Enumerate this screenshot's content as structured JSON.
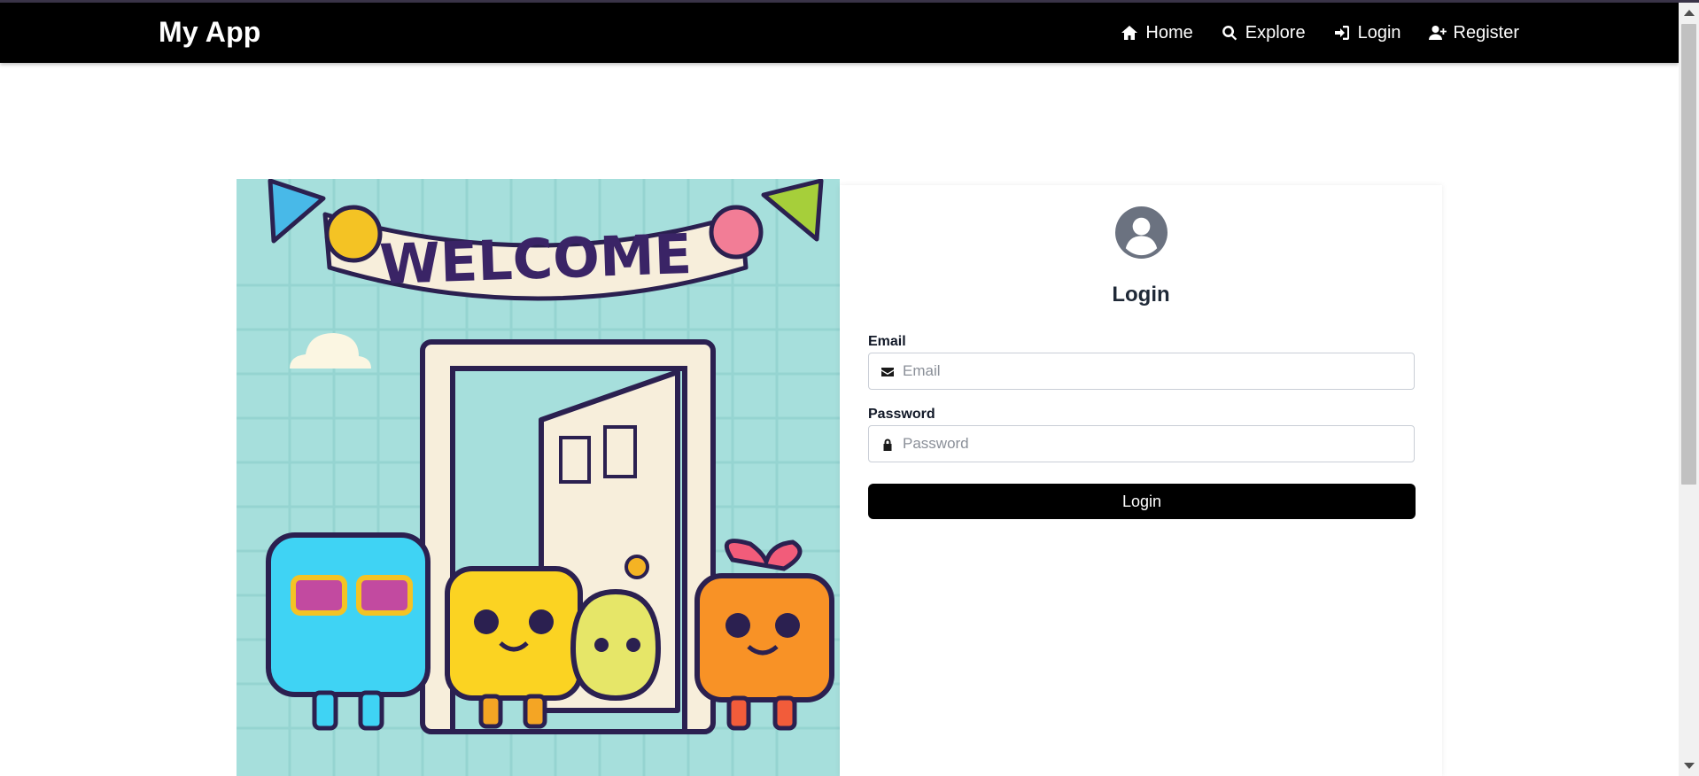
{
  "navbar": {
    "brand": "My App",
    "items": [
      {
        "label": "Home",
        "icon": "home-icon"
      },
      {
        "label": "Explore",
        "icon": "search-icon"
      },
      {
        "label": "Login",
        "icon": "sign-in-icon"
      },
      {
        "label": "Register",
        "icon": "user-plus-icon"
      }
    ]
  },
  "hero": {
    "banner_text": "WELCOME"
  },
  "login_form": {
    "title": "Login",
    "email_label": "Email",
    "email_placeholder": "Email",
    "password_label": "Password",
    "password_placeholder": "Password",
    "submit_label": "Login"
  },
  "colors": {
    "navbar_bg": "#000000",
    "button_bg": "#000000",
    "avatar": "#6b7280",
    "hero_bg": "#a6dfdc"
  }
}
